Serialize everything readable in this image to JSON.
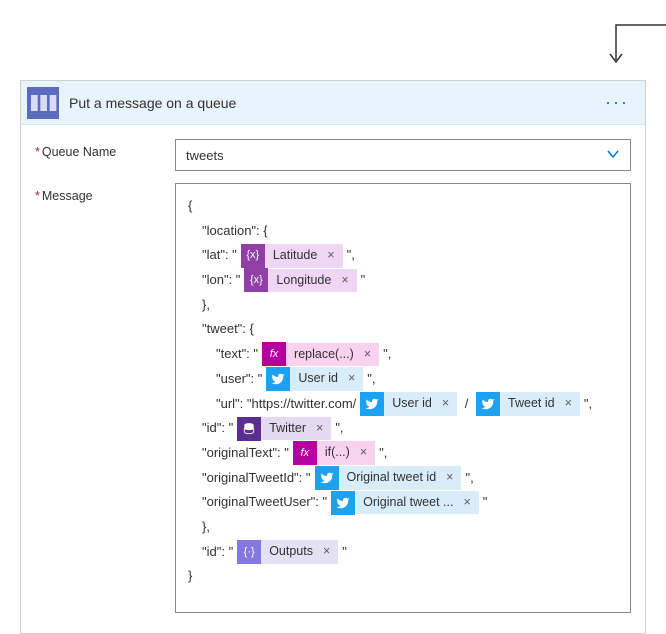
{
  "card": {
    "title": "Put a message on a queue",
    "labels": {
      "queueName": "Queue Name",
      "message": "Message"
    },
    "queueValue": "tweets",
    "menu": "···"
  },
  "msg": {
    "open": "{",
    "locKey": "\"location\": {",
    "latKey": "\"lat\": \"",
    "lonKey": "\"lon\": \"",
    "closeObj": "},",
    "tweetKey": "\"tweet\": {",
    "textKey": "\"text\": \"",
    "userKey": "\"user\": \"",
    "urlKey": "\"url\": \"https://twitter.com/",
    "idKey": "\"id\": \"",
    "origTextKey": "\"originalText\": \"",
    "origIdKey": "\"originalTweetId\": \"",
    "origUserKey": "\"originalTweetUser\": \"",
    "slash": " / ",
    "tailComma": "\",",
    "tail": "\"",
    "close": "}"
  },
  "tokens": {
    "latitude": "Latitude",
    "longitude": "Longitude",
    "replace": "replace(...)",
    "userId": "User id",
    "tweetId": "Tweet id",
    "twitter": "Twitter",
    "ifExpr": "if(...)",
    "origTweetId": "Original tweet id",
    "origTweetUser": "Original tweet ...",
    "outputs": "Outputs"
  }
}
